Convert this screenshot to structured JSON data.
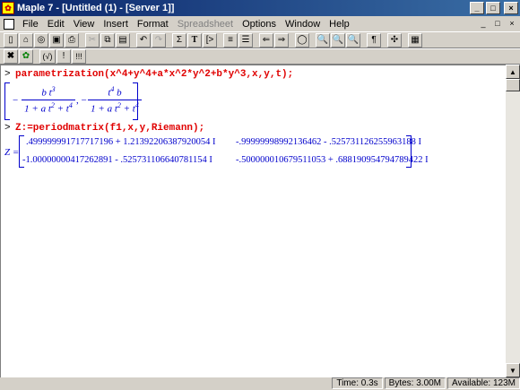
{
  "window": {
    "title": "Maple 7 - [Untitled (1) - [Server 1]]",
    "minimize": "_",
    "maximize": "□",
    "close": "×"
  },
  "menu": {
    "items": [
      "File",
      "Edit",
      "View",
      "Insert",
      "Format",
      "Spreadsheet",
      "Options",
      "Window",
      "Help"
    ],
    "disabled": [
      "Spreadsheet"
    ]
  },
  "toolbar": {
    "icons": [
      "new-document",
      "open",
      "open-url",
      "save",
      "print",
      "cut",
      "copy",
      "paste",
      "undo",
      "redo",
      "sum-text",
      "text",
      "execute-group",
      "indent",
      "outdent",
      "back",
      "forward",
      "stop",
      "zoom-100",
      "zoom-200",
      "zoom-400",
      "paragraph",
      "restart",
      "debug"
    ],
    "text_labels": {
      "sum": "Σ",
      "text": "T",
      "paragraph": "¶",
      "check": "(√)",
      "bang": "!",
      "bangs": "!!!"
    }
  },
  "worksheet": {
    "prompt": ">",
    "input1": "parametrization(x^4+y^4+a*x^2*y^2+b*y^3,x,y,t);",
    "output1": {
      "frac1_num": "b t",
      "frac1_num_exp": "3",
      "frac1_den": "1 + a t",
      "frac1_den_exp1": "2",
      "frac1_den_tail": " + t",
      "frac1_den_exp2": "4",
      "frac2_num": "t",
      "frac2_num_exp": "4",
      "frac2_num_tail": " b",
      "frac2_den": "1 + a t",
      "frac2_den_exp1": "2",
      "frac2_den_tail": " + t",
      "frac2_den_exp2": "4"
    },
    "input2": "Z:=periodmatrix(f1,x,y,Riemann);",
    "output2": {
      "lhs": "Z =",
      "r1c1": ".499999991717717196 + 1.21392206387920054 I",
      "r1c2": "-.99999998992136462 - .525731126255963188 I",
      "r2c1": "-1.00000000417262891 - .525731106640781154 I",
      "r2c2": "-.500000010679511053 + .688190954794789422 I"
    }
  },
  "status": {
    "time": "Time:  0.3s",
    "bytes": "Bytes: 3.00M",
    "available": "Available: 123M"
  }
}
